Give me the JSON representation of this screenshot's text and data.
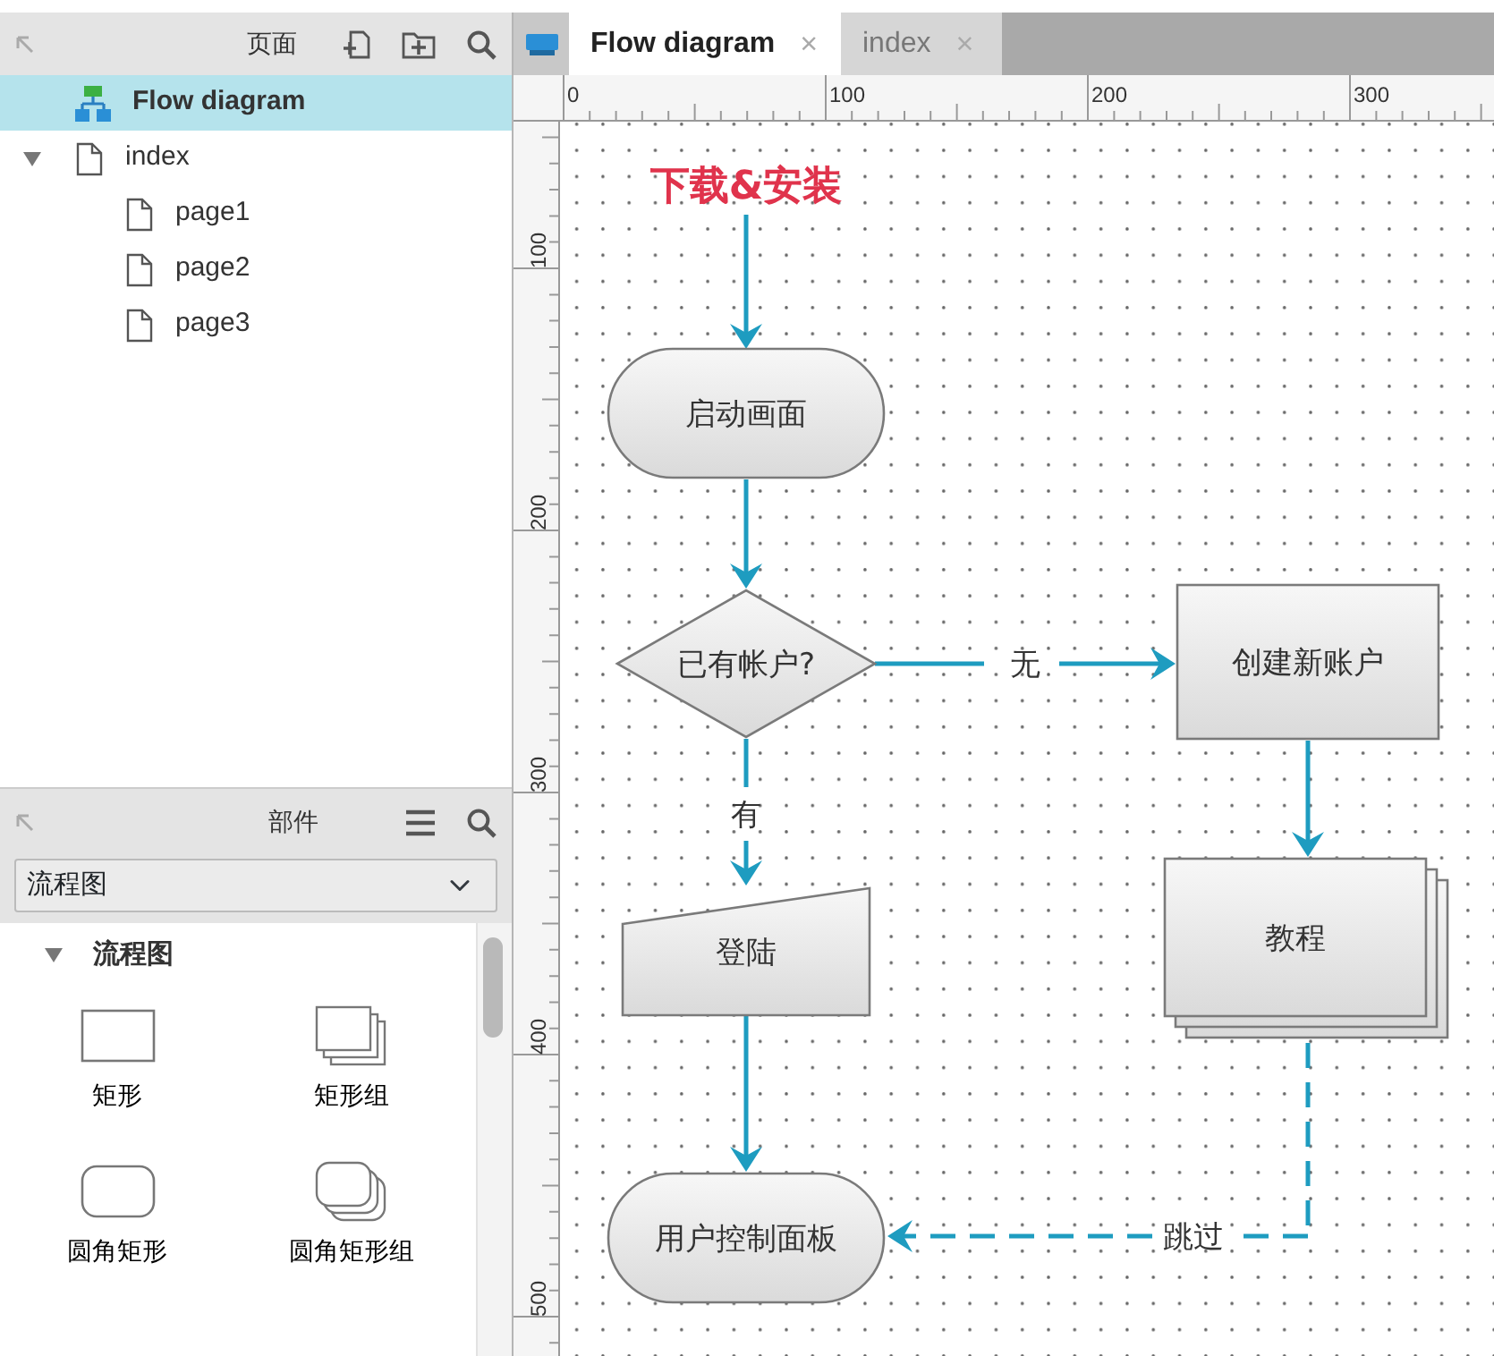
{
  "pages_panel": {
    "title": "页面",
    "tree": [
      {
        "label": "Flow diagram",
        "kind": "flow",
        "selected": true
      },
      {
        "label": "index",
        "kind": "page",
        "selected": false,
        "expanded": true,
        "children": [
          {
            "label": "page1",
            "kind": "page",
            "selected": false
          },
          {
            "label": "page2",
            "kind": "page",
            "selected": false
          },
          {
            "label": "page3",
            "kind": "page",
            "selected": false
          }
        ]
      }
    ]
  },
  "widgets_panel": {
    "title": "部件",
    "library": "流程图",
    "section": {
      "label": "流程图",
      "expanded": true
    },
    "widgets": [
      {
        "label": "矩形",
        "kind": "rectangle"
      },
      {
        "label": "矩形组",
        "kind": "rectangle-group"
      },
      {
        "label": "圆角矩形",
        "kind": "rounded"
      },
      {
        "label": "圆角矩形组",
        "kind": "rounded-group"
      }
    ]
  },
  "tabs": [
    {
      "label": "Flow diagram",
      "close": "×",
      "selected": true
    },
    {
      "label": "index",
      "close": "×",
      "selected": false
    }
  ],
  "ruler": {
    "x_labels": [
      "0",
      "100",
      "200",
      "300"
    ],
    "y_labels": [
      "100",
      "200",
      "300",
      "400",
      "500"
    ]
  },
  "diagram": {
    "nodes": [
      {
        "kind": "title",
        "text": "下载&安装"
      },
      {
        "kind": "terminal",
        "text": "启动画面"
      },
      {
        "kind": "decision",
        "text": "已有帐户?"
      },
      {
        "kind": "process",
        "text": "创建新账户"
      },
      {
        "kind": "manual-input",
        "text": "登陆"
      },
      {
        "kind": "stacked",
        "text": "教程"
      },
      {
        "kind": "terminal",
        "text": "用户控制面板"
      }
    ],
    "edges": [
      {
        "dashed": false
      },
      {
        "dashed": false
      },
      {
        "dashed": false,
        "label": "无"
      },
      {
        "dashed": false,
        "label": "有"
      },
      {
        "dashed": false
      },
      {
        "dashed": false
      },
      {
        "dashed": true,
        "label": "跳过"
      }
    ]
  }
}
